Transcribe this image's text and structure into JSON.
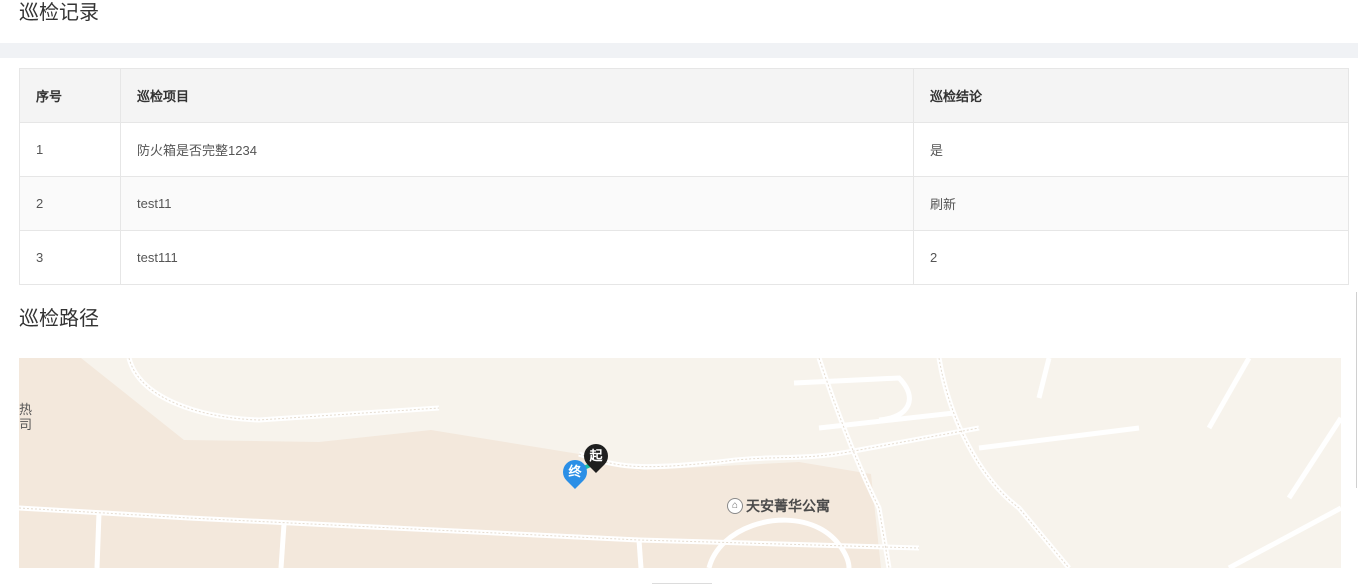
{
  "records_section": {
    "title": "巡检记录"
  },
  "table": {
    "headers": [
      "序号",
      "巡检项目",
      "巡检结论"
    ],
    "rows": [
      [
        "1",
        "防火箱是否完整1234",
        "是"
      ],
      [
        "2",
        "test11",
        "刷新"
      ],
      [
        "3",
        "test111",
        "2"
      ]
    ]
  },
  "path_section": {
    "title": "巡检路径"
  },
  "map": {
    "edge_label": "热\n司",
    "poi_label": "天安菁华公寓",
    "start_marker": "起",
    "end_marker": "终"
  }
}
